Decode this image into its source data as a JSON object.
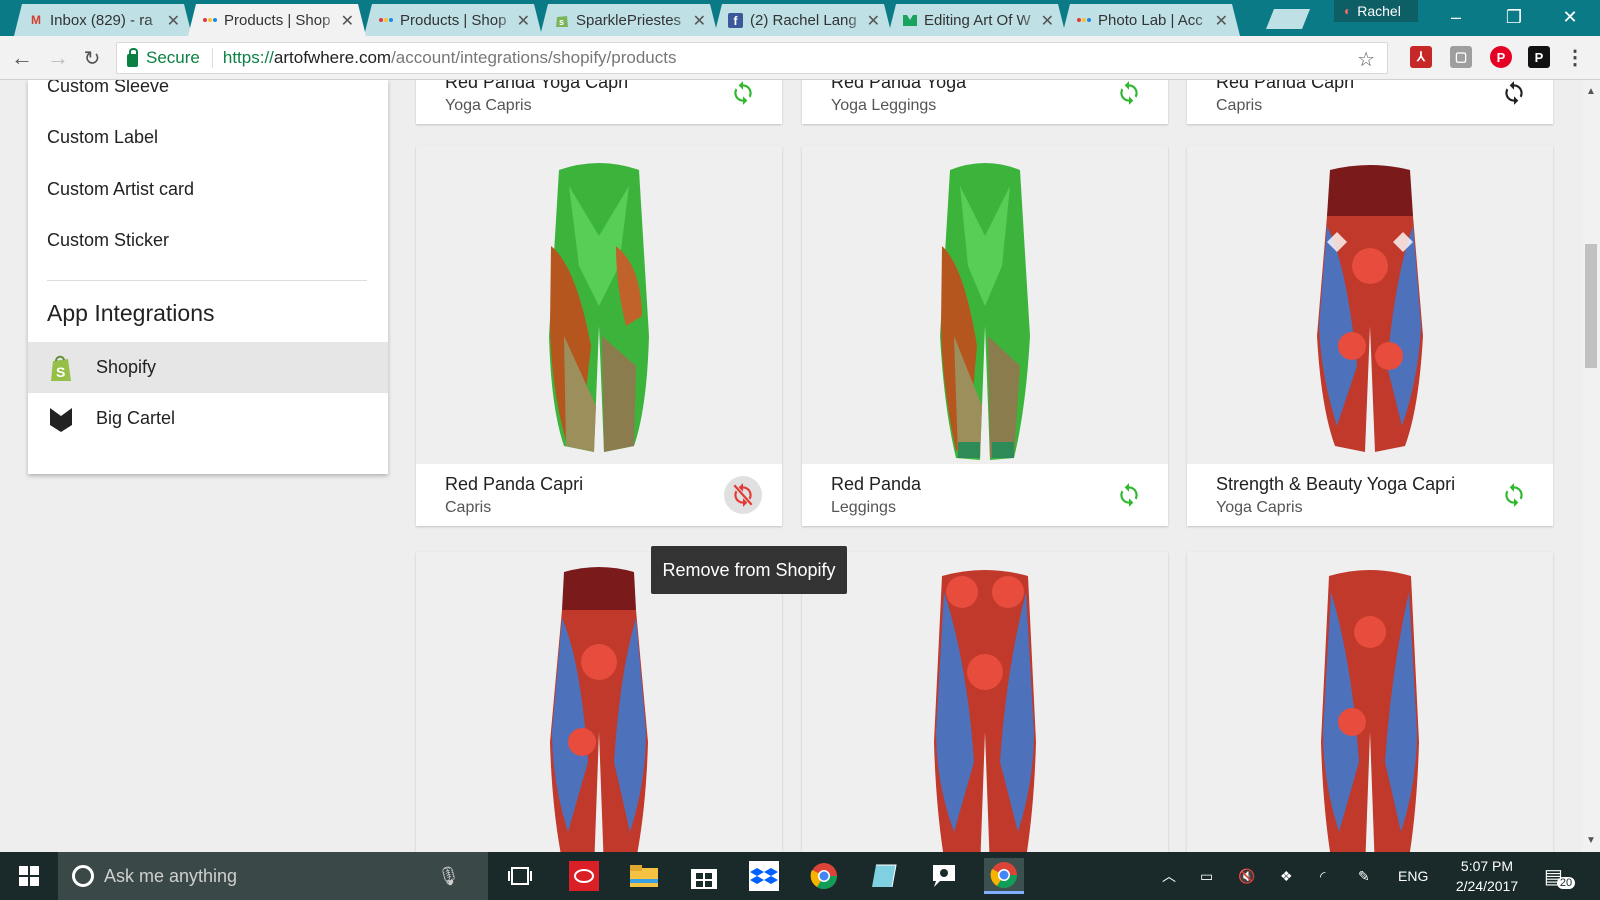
{
  "browser": {
    "tabs": [
      {
        "title": "Inbox (829) - ra",
        "icon": "gmail-icon"
      },
      {
        "title": "Products | Shop",
        "icon": "artofwhere-icon",
        "active": true
      },
      {
        "title": "Products | Shop",
        "icon": "artofwhere-icon"
      },
      {
        "title": "SparklePriestes",
        "icon": "shopify-icon"
      },
      {
        "title": "(2) Rachel Lang",
        "icon": "facebook-icon"
      },
      {
        "title": "Editing Art Of W",
        "icon": "bigcartel-icon"
      },
      {
        "title": "Photo Lab | Acc",
        "icon": "artofwhere-icon"
      }
    ],
    "profile_name": "Rachel",
    "secure_label": "Secure",
    "url_scheme": "https://",
    "url_host": "artofwhere.com",
    "url_path": "/account/integrations/shopify/products"
  },
  "sidebar": {
    "links": [
      "Custom Sleeve",
      "Custom Label",
      "Custom Artist card",
      "Custom Sticker"
    ],
    "heading": "App Integrations",
    "items": [
      {
        "label": "Shopify",
        "icon": "shopify-icon",
        "active": true
      },
      {
        "label": "Big Cartel",
        "icon": "bigcartel-icon",
        "active": false
      }
    ]
  },
  "products": [
    {
      "name": "Red Panda Yoga Capri",
      "type": "Yoga Capris",
      "sync": "synced",
      "art": "none"
    },
    {
      "name": "Red Panda Yoga",
      "type": "Yoga Leggings",
      "sync": "synced",
      "art": "none"
    },
    {
      "name": "Red Panda Capri",
      "type": "Capris",
      "sync": "not-synced",
      "art": "none"
    },
    {
      "name": "Red Panda Capri",
      "type": "Capris",
      "sync": "remove-hover",
      "art": "panda-capri"
    },
    {
      "name": "Red Panda",
      "type": "Leggings",
      "sync": "synced",
      "art": "panda-legging"
    },
    {
      "name": "Strength & Beauty Yoga Capri",
      "type": "Yoga Capris",
      "sync": "synced",
      "art": "roses-capri"
    },
    {
      "name": "",
      "type": "",
      "sync": "",
      "art": "roses-capri"
    },
    {
      "name": "",
      "type": "",
      "sync": "",
      "art": "roses-legging"
    },
    {
      "name": "",
      "type": "",
      "sync": "",
      "art": "roses-legging"
    }
  ],
  "tooltip": "Remove from Shopify",
  "taskbar": {
    "search_placeholder": "Ask me anything",
    "language": "ENG",
    "time": "5:07 PM",
    "date": "2/24/2017",
    "notifications": "20"
  },
  "colors": {
    "sync_green": "#2eb82e",
    "remove_red": "#e53935",
    "tabstrip": "#0a7a86"
  }
}
